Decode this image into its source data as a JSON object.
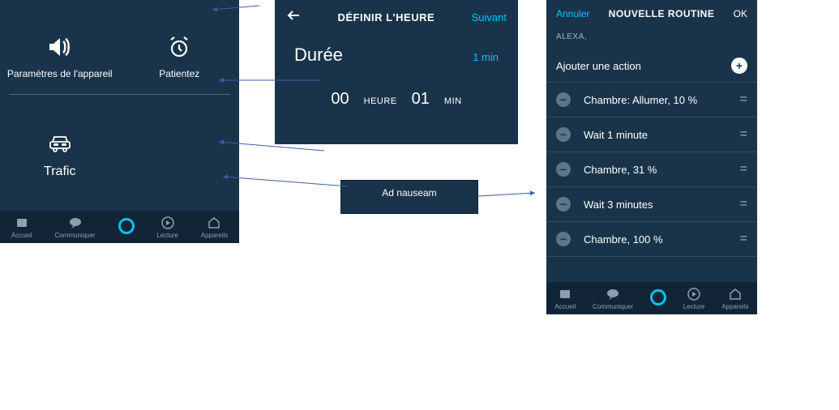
{
  "panel1": {
    "tiles": [
      {
        "label": "Paramètres de l'appareil"
      },
      {
        "label": "Patientez"
      }
    ],
    "tile_trafic": "Trafic",
    "nav": [
      "Accueil",
      "Communiquer",
      "",
      "Lecture",
      "Appareils"
    ]
  },
  "panel2": {
    "title": "DÉFINIR L'HEURE",
    "next": "Suivant",
    "duree": "Durée",
    "value_label": "1 min",
    "hours": "00",
    "hours_label": "HEURE",
    "mins": "01",
    "mins_label": "MIN"
  },
  "adbox": "Ad nauseam",
  "panel3": {
    "cancel": "Annuler",
    "title": "NOUVELLE ROUTINE",
    "ok": "OK",
    "alexa": "ALEXA,",
    "add_action": "Ajouter une action",
    "items": [
      "Chambre: Allumer, 10 %",
      "Wait  1 minute",
      "Chambre, 31 %",
      "Wait  3 minutes",
      "Chambre, 100 %"
    ],
    "nav": [
      "Accueil",
      "Communiquer",
      "",
      "Lecture",
      "Appareils"
    ]
  }
}
